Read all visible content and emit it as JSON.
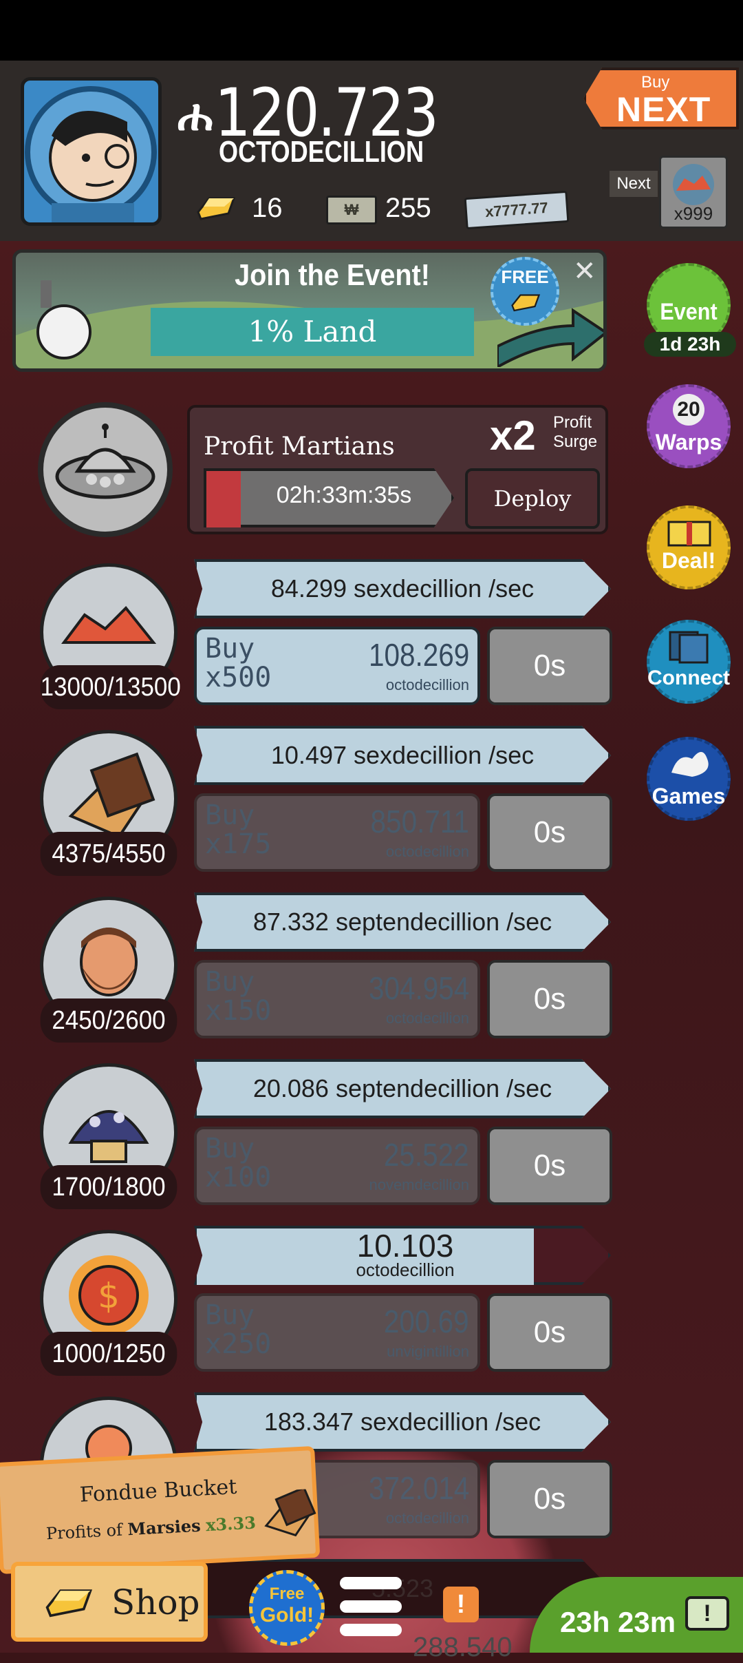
{
  "header": {
    "money_amount": "120.723",
    "money_unit": "OCTODECILLION",
    "gold_count": "16",
    "megabucks_count": "255",
    "bill_label": "x7777.77",
    "buy_next_small": "Buy",
    "buy_next_big": "NEXT",
    "next_label": "Next",
    "next_item_count": "x999"
  },
  "event_banner": {
    "title": "Join the Event!",
    "subtitle": "1% Land",
    "free_label": "FREE",
    "close_symbol": "✕"
  },
  "side_buttons": [
    {
      "label": "Event",
      "sub": "1d 23h",
      "color": "#6cc23a"
    },
    {
      "label": "Warps",
      "badge": "20",
      "color": "#9a4fc0"
    },
    {
      "label": "Deal!",
      "color": "#e7b51e"
    },
    {
      "label": "Connect",
      "color": "#1f8fbf"
    },
    {
      "label": "Games",
      "color": "#1c4fa8"
    }
  ],
  "manager": {
    "name": "Profit Martians",
    "multiplier": "x2",
    "surge_line1": "Profit",
    "surge_line2": "Surge",
    "timer": "02h:33m:35s",
    "deploy_label": "Deploy"
  },
  "businesses": [
    {
      "count": "13000/13500",
      "rate": "84.299 sexdecillion /sec",
      "buy_word": "Buy",
      "buy_qty": "x500",
      "cost": "108.269",
      "cost_unit": "octodecillion",
      "timer": "0s",
      "active": true
    },
    {
      "count": "4375/4550",
      "rate": "10.497 sexdecillion /sec",
      "buy_word": "Buy",
      "buy_qty": "x175",
      "cost": "850.711",
      "cost_unit": "octodecillion",
      "timer": "0s",
      "active": false
    },
    {
      "count": "2450/2600",
      "rate": "87.332 septendecillion /sec",
      "buy_word": "Buy",
      "buy_qty": "x150",
      "cost": "304.954",
      "cost_unit": "octodecillion",
      "timer": "0s",
      "active": false
    },
    {
      "count": "1700/1800",
      "rate": "20.086 septendecillion /sec",
      "buy_word": "Buy",
      "buy_qty": "x100",
      "cost": "25.522",
      "cost_unit": "novemdecillion",
      "timer": "0s",
      "active": false
    },
    {
      "count": "1000/1250",
      "rate_big": "10.103",
      "rate_unit": "octodecillion",
      "progress": 0.82,
      "buy_word": "Buy",
      "buy_qty": "x250",
      "cost": "200.69",
      "cost_unit": "unvigintillion",
      "timer": "0s",
      "active": false
    },
    {
      "count": "",
      "rate": "183.347 sexdecillion /sec",
      "buy_word": "Buy",
      "buy_qty": "",
      "cost": "372.014",
      "cost_unit": "octodecillion",
      "timer": "0s",
      "active": false
    }
  ],
  "partial_row": {
    "rate": "5.523",
    "cost": "288.540"
  },
  "promo": {
    "title": "Fondue Bucket",
    "text_prefix": "Profits of",
    "text_target": "Marsies",
    "text_mult": "x3.33"
  },
  "bottom": {
    "shop_label": "Shop",
    "free_gold_line1": "Free",
    "free_gold_line2": "Gold!",
    "alert_symbol": "!",
    "timer": "23h 23m",
    "tv_symbol": "!"
  },
  "colors": {
    "money": "#ffffff",
    "accent_orange": "#ee7b3b",
    "rate_bar": "#bcd2de",
    "gold": "#f6c43a"
  }
}
